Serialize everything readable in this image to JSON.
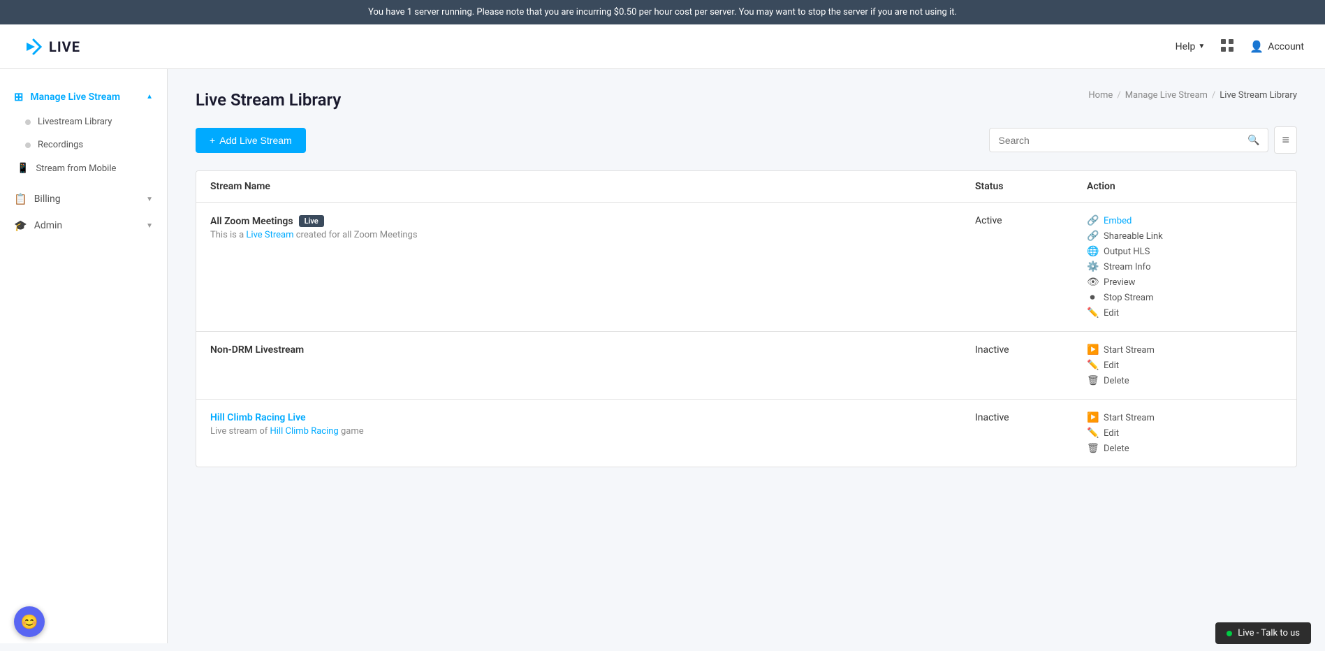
{
  "banner": {
    "text": "You have 1 server running. Please note that you are incurring $0.50 per hour cost per server. You may want to stop the server if you are not using it."
  },
  "header": {
    "logo_text": "LIVE",
    "help_label": "Help",
    "account_label": "Account"
  },
  "sidebar": {
    "main_item": {
      "label": "Manage Live Stream",
      "chevron": "▲"
    },
    "sub_items": [
      {
        "label": "Livestream Library"
      },
      {
        "label": "Recordings"
      }
    ],
    "mobile_item": {
      "label": "Stream from Mobile"
    },
    "other_items": [
      {
        "label": "Billing",
        "icon": "📋"
      },
      {
        "label": "Admin",
        "icon": "🎓"
      }
    ]
  },
  "page": {
    "title": "Live Stream Library",
    "breadcrumb": {
      "home": "Home",
      "section": "Manage Live Stream",
      "current": "Live Stream Library"
    }
  },
  "toolbar": {
    "add_label": "+ Add Live Stream",
    "search_placeholder": "Search",
    "filter_icon": "≡"
  },
  "table": {
    "columns": [
      "Stream Name",
      "Status",
      "Action"
    ],
    "rows": [
      {
        "name": "All Zoom Meetings",
        "badge": "Live",
        "description": "This is a Live Stream created for all Zoom Meetings",
        "description_link": "Live Stream",
        "status": "Active",
        "actions": [
          {
            "icon": "link",
            "label": "Embed",
            "highlight": true
          },
          {
            "icon": "link",
            "label": "Shareable Link"
          },
          {
            "icon": "globe",
            "label": "Output HLS"
          },
          {
            "icon": "gear",
            "label": "Stream Info"
          },
          {
            "icon": "eye",
            "label": "Preview"
          },
          {
            "icon": "stop",
            "label": "Stop Stream"
          },
          {
            "icon": "edit",
            "label": "Edit"
          }
        ]
      },
      {
        "name": "Non-DRM Livestream",
        "badge": null,
        "description": null,
        "description_link": null,
        "status": "Inactive",
        "actions": [
          {
            "icon": "play",
            "label": "Start Stream"
          },
          {
            "icon": "edit",
            "label": "Edit"
          },
          {
            "icon": "trash",
            "label": "Delete"
          }
        ]
      },
      {
        "name": "Hill Climb Racing Live",
        "badge": null,
        "description": "Live stream of Hill Climb Racing game",
        "description_link": "Hill Climb Racing",
        "status": "Inactive",
        "actions": [
          {
            "icon": "play",
            "label": "Start Stream"
          },
          {
            "icon": "edit",
            "label": "Edit"
          },
          {
            "icon": "trash",
            "label": "Delete"
          }
        ]
      }
    ]
  },
  "chat_widget": {
    "live_label": "Live - Talk to us"
  }
}
